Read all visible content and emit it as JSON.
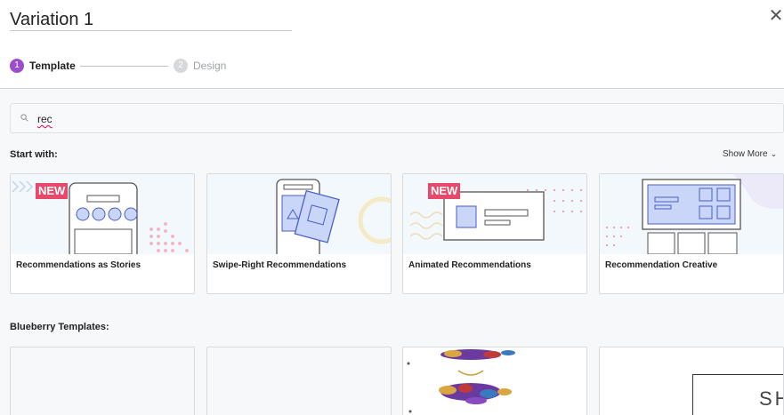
{
  "header": {
    "title_value": "Variation 1",
    "close_icon": "close-icon"
  },
  "stepper": {
    "steps": [
      {
        "number": "1",
        "label": "Template",
        "state": "active"
      },
      {
        "number": "2",
        "label": "Design",
        "state": "inactive"
      }
    ],
    "active_color": "#9b4dca"
  },
  "search": {
    "value": "rec",
    "icon": "search-icon"
  },
  "start_with": {
    "heading": "Start with:",
    "show_more": "Show More",
    "cards": [
      {
        "label": "Recommendations as Stories",
        "badge": "NEW"
      },
      {
        "label": "Swipe-Right Recommendations",
        "badge": ""
      },
      {
        "label": "Animated Recommendations",
        "badge": "NEW"
      },
      {
        "label": "Recommendation Creative",
        "badge": ""
      }
    ],
    "badge_color": "#e8496b"
  },
  "blueberry": {
    "heading": "Blueberry Templates:",
    "cards": [
      {
        "label": ""
      },
      {
        "label": ""
      },
      {
        "label": ""
      },
      {
        "label": "SH"
      }
    ]
  }
}
